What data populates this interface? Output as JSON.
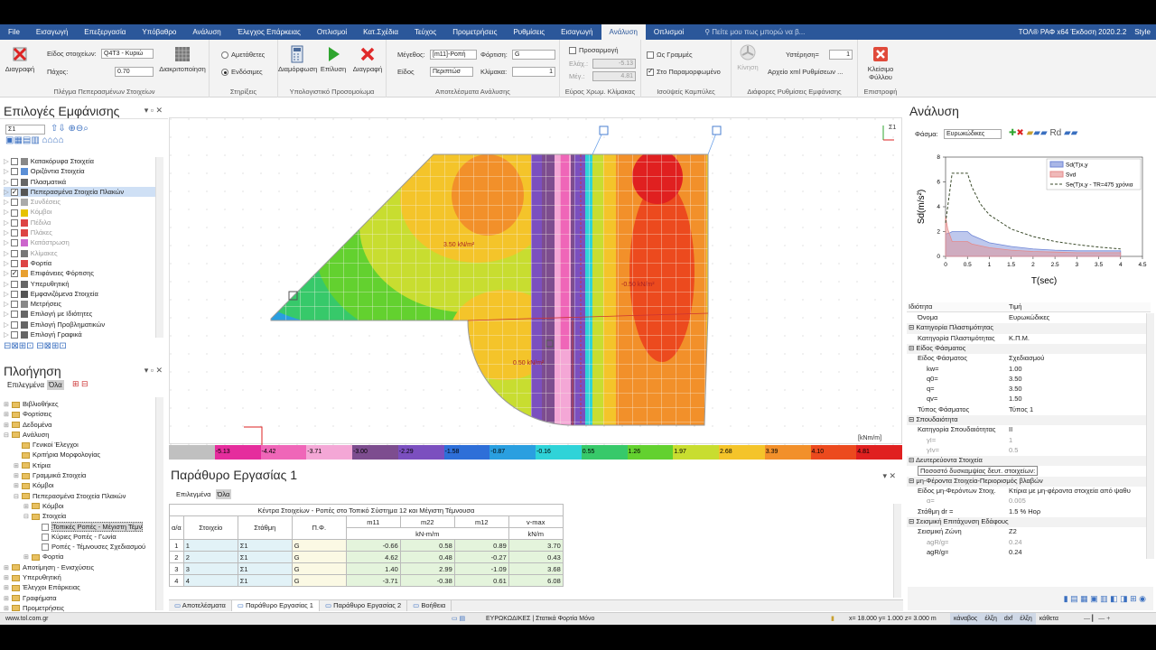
{
  "app": {
    "title": "ΤΟΛ® ΡΑΦ x64 Έκδοση 2020.2.2",
    "style_label": "Style"
  },
  "menu": {
    "tabs": [
      "File",
      "Εισαγωγή",
      "Επεξεργασία",
      "Υπόβαθρο",
      "Ανάλυση",
      "Έλεγχος Επάρκειας",
      "Οπλισμοί",
      "Κατ.Σχέδια",
      "Τεύχος",
      "Προμετρήσεις",
      "Ρυθμίσεις",
      "Εισαγωγή",
      "Ανάλυση",
      "Οπλισμοί"
    ],
    "active_index": 12,
    "tell_me": "Πείτε μου πως μπορώ να β..."
  },
  "ribbon": {
    "g1": {
      "delete_label": "Διαγραφή",
      "elem_type_label": "Είδος στοιχείων:",
      "elem_type_value": "Q4T3 - Κυριώ",
      "thickness_label": "Πάχος:",
      "thickness_value": "0.70",
      "discretize_label": "Διακριτοποίηση",
      "group_label": "Πλέγμα Πεπερασμένων Στοιχείων"
    },
    "g2": {
      "opt1": "Αμετάθετες",
      "opt2": "Ενδόσιμες",
      "group_label": "Στηρίξεις"
    },
    "g3": {
      "form_label": "Διαμόρφωση",
      "solve_label": "Επίλυση",
      "delete_label": "Διαγραφή",
      "group_label": "Υπολογιστικό Προσομοίωμα"
    },
    "g4": {
      "size_label": "Μέγεθος:",
      "size_value": "[m11]-Ροπή",
      "kind_label": "Είδος",
      "kind_value": "Περιπτώσ",
      "load_label": "Φόρτιση:",
      "load_value": "G",
      "scale_label": "Κλίμακα:",
      "scale_value": "1",
      "group_label": "Αποτελέσματα Ανάλυσης"
    },
    "g5": {
      "custom_label": "Προσαρμογή",
      "min_label": "Ελάχ.:",
      "min_value": "-5.13",
      "max_label": "Μέγ.:",
      "max_value": "4.81",
      "group_label": "Εύρος Χρωμ. Κλίμακας"
    },
    "g6": {
      "lines_label": "Ως Γραμμές",
      "deformed_label": "Στο Παραμορφωμένο",
      "group_label": "Ισοϋψείς Καμπύλες"
    },
    "g7": {
      "motion_label": "Κίνηση",
      "delay_label": "Υστέρηση=",
      "delay_value": "1",
      "xml_label": "Αρχείο xml Ρυθμίσεων ...",
      "group_label": "Διάφορες Ρυθμίσεις Εμφάνισης"
    },
    "g8": {
      "close_label": "Κλείσιμο Φύλλου",
      "group_label": "Επιστροφή"
    }
  },
  "display_panel": {
    "title": "Επιλογές Εμφάνισης",
    "level": "Σ1",
    "items": [
      {
        "label": "Κατακόρυφα Στοιχεία",
        "checked": false,
        "color": "#888"
      },
      {
        "label": "Οριζόντια Στοιχεία",
        "checked": false,
        "color": "#5b8fd6"
      },
      {
        "label": "Πλασματικά",
        "checked": false,
        "color": "#666"
      },
      {
        "label": "Πεπερασμένα Στοιχεία Πλακών",
        "checked": true,
        "color": "#555",
        "selected": true
      },
      {
        "label": "Συνδέσεις",
        "checked": false,
        "color": "#aaa",
        "dim": true
      },
      {
        "label": "Κόμβοι",
        "checked": false,
        "color": "#e6c200",
        "dim": true
      },
      {
        "label": "Πέδιλα",
        "checked": false,
        "color": "#d44",
        "dim": true
      },
      {
        "label": "Πλάκες",
        "checked": false,
        "color": "#d44",
        "dim": true
      },
      {
        "label": "Κατάστρωση",
        "checked": false,
        "color": "#c6c",
        "dim": true
      },
      {
        "label": "Κλίμακες",
        "checked": false,
        "color": "#777",
        "dim": true
      },
      {
        "label": "Φορτία",
        "checked": false,
        "color": "#d44"
      },
      {
        "label": "Επιφάνειες Φόρτισης",
        "checked": true,
        "color": "#e8a030"
      },
      {
        "label": "Υπερυθητική",
        "checked": false,
        "color": "#666"
      },
      {
        "label": "Εμφανιζόμενα Στοιχεία",
        "checked": false,
        "color": "#555"
      },
      {
        "label": "Μετρήσεις",
        "checked": false,
        "color": "#888"
      },
      {
        "label": "Επιλογή με Ιδιότητες",
        "checked": false,
        "color": "#666"
      },
      {
        "label": "Επιλογή Προβληματικών",
        "checked": false,
        "color": "#666"
      },
      {
        "label": "Επιλογή Γραφικά",
        "checked": false,
        "color": "#666"
      }
    ]
  },
  "nav_panel": {
    "title": "Πλοήγηση",
    "tab_selected": "Επιλεγμένα",
    "tab_all": "Όλα",
    "items": [
      {
        "label": "Βιβλιοθήκες",
        "level": 0,
        "exp": "+"
      },
      {
        "label": "Φορτίσεις",
        "level": 0,
        "exp": "+"
      },
      {
        "label": "Δεδομένα",
        "level": 0,
        "exp": "+"
      },
      {
        "label": "Ανάλυση",
        "level": 0,
        "exp": "-"
      },
      {
        "label": "Γενικοί Έλεγχοι",
        "level": 1,
        "exp": ""
      },
      {
        "label": "Κριτήρια Μορφολογίας",
        "level": 1,
        "exp": ""
      },
      {
        "label": "Κτίρια",
        "level": 1,
        "exp": "+"
      },
      {
        "label": "Γραμμικά Στοιχεία",
        "level": 1,
        "exp": "+"
      },
      {
        "label": "Κόμβοι",
        "level": 1,
        "exp": "+"
      },
      {
        "label": "Πεπερασμένα Στοιχεία Πλακών",
        "level": 1,
        "exp": "-"
      },
      {
        "label": "Κόμβοι",
        "level": 2,
        "exp": "+"
      },
      {
        "label": "Στοιχεία",
        "level": 2,
        "exp": "-"
      },
      {
        "label": "Τοπικές Ροπές - Μέγιστη Τέμν",
        "level": 3,
        "exp": "",
        "selected": true
      },
      {
        "label": "Κύριες Ροπές - Γωνία",
        "level": 3,
        "exp": ""
      },
      {
        "label": "Ροπές - Τέμνουσες Σχεδιασμού",
        "level": 3,
        "exp": ""
      },
      {
        "label": "Φορτία",
        "level": 2,
        "exp": "+"
      },
      {
        "label": "Αποτίμηση - Ενισχύσεις",
        "level": 0,
        "exp": "+"
      },
      {
        "label": "Υπερυθητική",
        "level": 0,
        "exp": "+"
      },
      {
        "label": "Έλεγχοι Επάρκειας",
        "level": 0,
        "exp": "+"
      },
      {
        "label": "Γραφήματα",
        "level": 0,
        "exp": "+"
      },
      {
        "label": "Προμετρήσεις",
        "level": 0,
        "exp": "+"
      }
    ]
  },
  "canvas": {
    "labels": [
      "3.50 kN/m²",
      "-0.50 kN/m²",
      "0.50 kN/m²"
    ],
    "unit": "[kNm/m]",
    "level_tag": "Σ1"
  },
  "legend": {
    "values": [
      "",
      "-5.13",
      "-4.42",
      "-3.71",
      "-3.00",
      "-2.29",
      "-1.58",
      "-0.87",
      "-0.16",
      "0.55",
      "1.26",
      "1.97",
      "2.68",
      "3.39",
      "4.10",
      "4.81"
    ],
    "colors": [
      "#c0c0c0",
      "#e52d9d",
      "#ef66b8",
      "#f4a7d6",
      "#7d4d8f",
      "#7b4fbf",
      "#2e6fd8",
      "#2a9fe0",
      "#2fd3d8",
      "#37c96a",
      "#63d12f",
      "#c8dd30",
      "#f4c42a",
      "#f2902a",
      "#ec4a1e",
      "#e02020"
    ]
  },
  "work": {
    "title": "Παράθυρο Εργασίας 1",
    "tab_selected": "Επιλεγμένα",
    "tab_all": "Όλα",
    "table_title": "Κέντρα Στοιχείων - Ροπές στο Τοπικό Σύστημα 12 και Μέγιστη Τέμνουσα",
    "headers": [
      "α/α",
      "Στοιχείο",
      "Στάθμη",
      "Π.Φ.",
      "m11",
      "m22",
      "m12",
      "v-max"
    ],
    "units": [
      "kN-m/m",
      "kN/m"
    ],
    "rows": [
      [
        "1",
        "1",
        "Σ1",
        "G",
        "-0.66",
        "0.58",
        "0.89",
        "3.70"
      ],
      [
        "2",
        "2",
        "Σ1",
        "G",
        "4.62",
        "0.48",
        "-0.27",
        "0.43"
      ],
      [
        "3",
        "3",
        "Σ1",
        "G",
        "1.40",
        "2.99",
        "-1.09",
        "3.68"
      ],
      [
        "4",
        "4",
        "Σ1",
        "G",
        "-3.71",
        "-0.38",
        "0.61",
        "6.08"
      ]
    ]
  },
  "bottom_tabs": [
    "Αποτελέσματα",
    "Παράθυρο Εργασίας 1",
    "Παράθυρο Εργασίας 2",
    "Βοήθεια"
  ],
  "analysis": {
    "title": "Ανάλυση",
    "spectrum_label": "Φάσμα:",
    "spectrum_value": "Ευρωκώδικες",
    "col_prop": "Ιδιότητα",
    "col_val": "Τιμή",
    "props": [
      {
        "k": "Όνομα",
        "v": "Ευρωκώδικες",
        "cat": false
      },
      {
        "k": "Κατηγορία Πλαστιμότητας",
        "v": "",
        "cat": true
      },
      {
        "k": "Κατηγορία Πλαστιμότητας",
        "v": "Κ.Π.Μ.",
        "cat": false
      },
      {
        "k": "Είδος Φάσματος",
        "v": "",
        "cat": true
      },
      {
        "k": "Είδος Φάσματος",
        "v": "Σχεδιασμού",
        "cat": false
      },
      {
        "k": "kw=",
        "v": "1.00",
        "cat": false,
        "ind": true
      },
      {
        "k": "q0=",
        "v": "3.50",
        "cat": false,
        "ind": true
      },
      {
        "k": "q=",
        "v": "3.50",
        "cat": false,
        "ind": true
      },
      {
        "k": "qv=",
        "v": "1.50",
        "cat": false,
        "ind": true
      },
      {
        "k": "Τύπος Φάσματος",
        "v": "Τύπος 1",
        "cat": false
      },
      {
        "k": "Σπουδαιότητα",
        "v": "",
        "cat": true
      },
      {
        "k": "Κατηγορία Σπουδαιότητας",
        "v": "II",
        "cat": false
      },
      {
        "k": "γI=",
        "v": "1",
        "cat": false,
        "ind": true,
        "dim": true
      },
      {
        "k": "γIv=",
        "v": "0.5",
        "cat": false,
        "ind": true,
        "dim": true
      },
      {
        "k": "Δευτερεύοντα Στοιχεία",
        "v": "",
        "cat": true
      },
      {
        "k": "Ποσοστό δυσκαμψίας δευτ. στοιχείων:",
        "v": "",
        "cat": false,
        "box": true
      },
      {
        "k": "μη-Φέροντα Στοιχεία-Περιορισμός βλαβών",
        "v": "",
        "cat": true
      },
      {
        "k": "Είδος μη-Φερόντων Στοιχ.",
        "v": "Κτίρια με μη-φέροντα στοιχεία από ψαθυ",
        "cat": false
      },
      {
        "k": "α=",
        "v": "0.005",
        "cat": false,
        "ind": true,
        "dim": true
      },
      {
        "k": "Στάθμη dr =",
        "v": "1.5 % Hορ",
        "cat": false
      },
      {
        "k": "Σεισμική Επιτάχυνση Εδάφους",
        "v": "",
        "cat": true
      },
      {
        "k": "Σεισμική Ζώνη",
        "v": "Z2",
        "cat": false
      },
      {
        "k": "agR/g=",
        "v": "0.24",
        "cat": false,
        "ind": true,
        "dim": true
      },
      {
        "k": "agR/g=",
        "v": "0.24",
        "cat": false,
        "ind": true
      }
    ]
  },
  "chart_data": {
    "type": "line",
    "xlabel": "T(sec)",
    "ylabel": "Sd(m/s²)",
    "xlim": [
      0,
      4.5
    ],
    "ylim": [
      0,
      8
    ],
    "xticks": [
      0,
      0.5,
      1,
      1.5,
      2,
      2.5,
      3,
      3.5,
      4,
      4.5
    ],
    "yticks": [
      0,
      2,
      4,
      6,
      8
    ],
    "legend_pos": "top-right",
    "series": [
      {
        "name": "Sd(T)x,y",
        "color": "#6f86d6",
        "type": "area",
        "x": [
          0,
          0.1,
          0.15,
          0.5,
          0.6,
          1,
          1.5,
          2,
          2.5,
          3,
          3.5,
          4
        ],
        "y": [
          1.8,
          1.9,
          2.0,
          2.0,
          1.7,
          1.1,
          0.8,
          0.6,
          0.5,
          0.45,
          0.45,
          0.45
        ]
      },
      {
        "name": "Svd",
        "color": "#e58a8a",
        "type": "area",
        "x": [
          0,
          0.05,
          0.15,
          0.5,
          0.6,
          1,
          1.5,
          2,
          2.5,
          3,
          3.5,
          4
        ],
        "y": [
          3.2,
          2.2,
          1.2,
          1.2,
          1.0,
          0.7,
          0.5,
          0.4,
          0.35,
          0.3,
          0.3,
          0.3
        ]
      },
      {
        "name": "Se(T)x,y - TR=475 χρόνια",
        "color": "#3a4a2a",
        "type": "dash",
        "x": [
          0,
          0.15,
          0.5,
          0.6,
          0.8,
          1,
          1.5,
          2,
          2.5,
          3,
          3.5,
          4
        ],
        "y": [
          2.7,
          6.7,
          6.7,
          5.6,
          4.2,
          3.35,
          2.2,
          1.6,
          1.2,
          0.95,
          0.75,
          0.6
        ]
      }
    ]
  },
  "status": {
    "site": "www.tol.com.gr",
    "mode": "ΕΥΡΩΚΩΔΙΚΕΣ | Στατικά Φορτία Μόνο",
    "coords": "x= 18.000 y= 1.000 z= 3.000 m",
    "snap": [
      "κάναβος",
      "έλξη",
      "dxf",
      "έλξη",
      "κάθετα"
    ]
  }
}
